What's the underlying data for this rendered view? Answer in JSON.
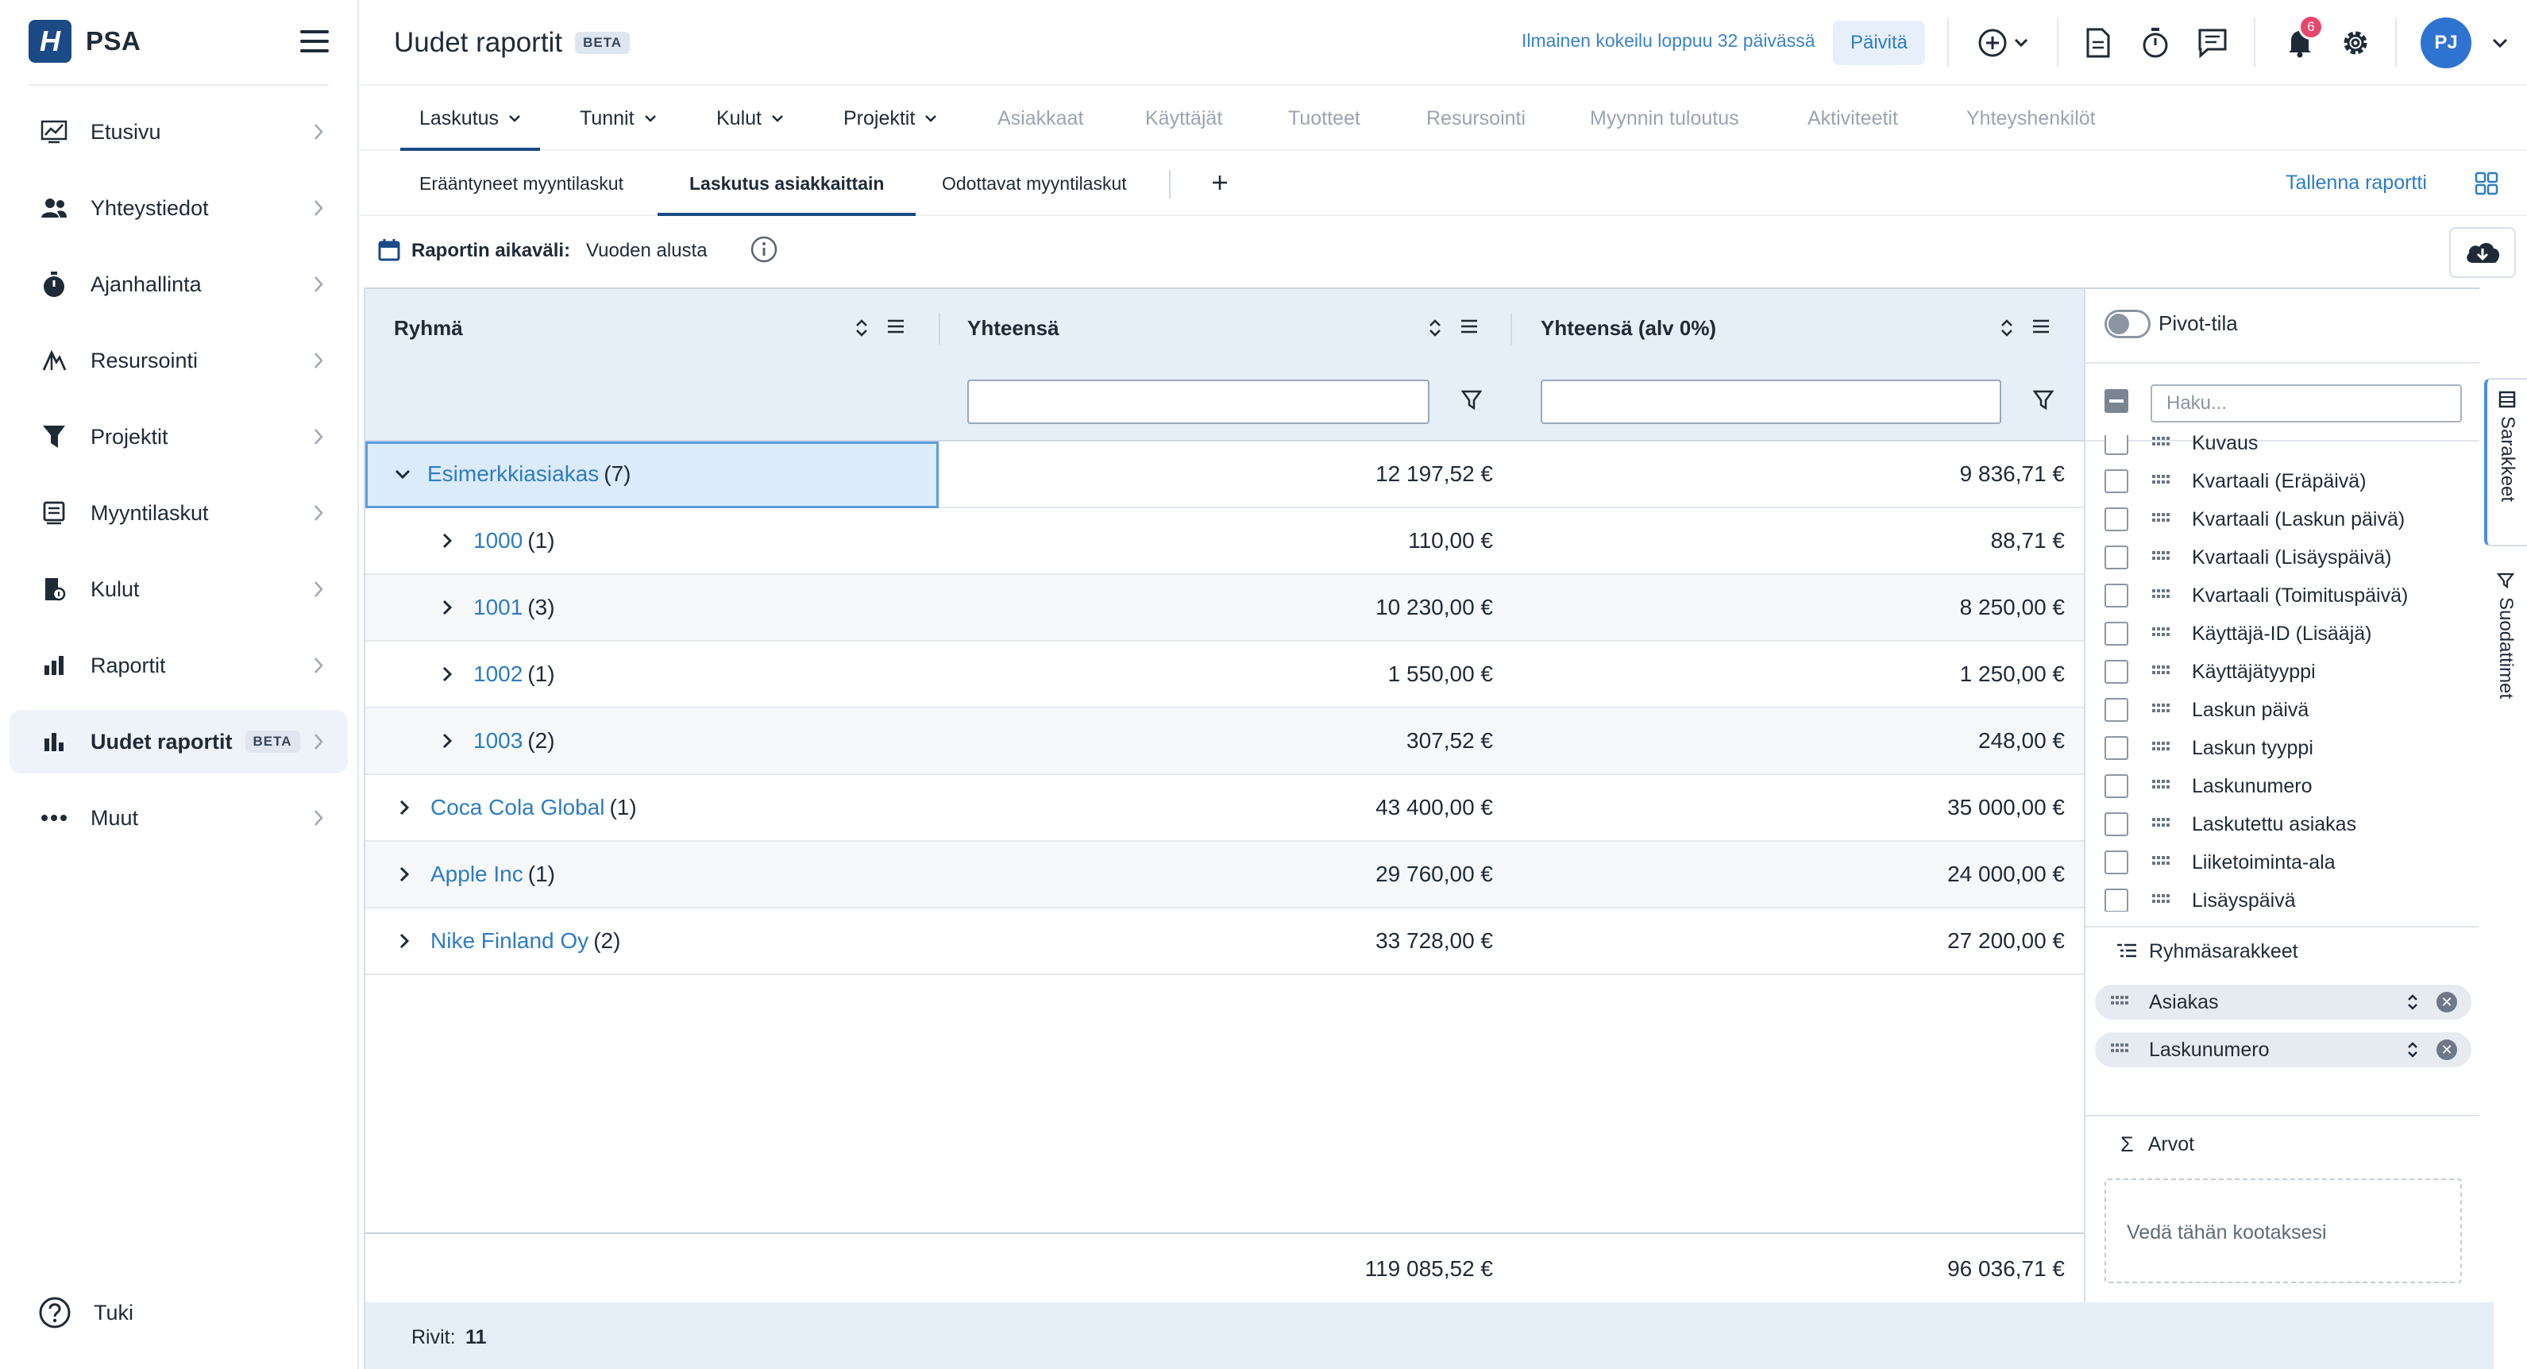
{
  "brand": {
    "logo_letter": "H",
    "name": "PSA"
  },
  "sidebar": {
    "items": [
      {
        "label": "Etusivu",
        "icon": "chart-line-icon"
      },
      {
        "label": "Yhteystiedot",
        "icon": "people-icon"
      },
      {
        "label": "Ajanhallinta",
        "icon": "stopwatch-icon"
      },
      {
        "label": "Resursointi",
        "icon": "resource-icon"
      },
      {
        "label": "Projektit",
        "icon": "funnel-icon"
      },
      {
        "label": "Myyntilaskut",
        "icon": "invoice-icon"
      },
      {
        "label": "Kulut",
        "icon": "receipt-icon"
      },
      {
        "label": "Raportit",
        "icon": "bar-chart-icon"
      },
      {
        "label": "Uudet raportit",
        "icon": "bar-chart-icon",
        "badge": "BETA",
        "active": true
      },
      {
        "label": "Muut",
        "icon": "more-icon"
      }
    ],
    "help_label": "Tuki"
  },
  "header": {
    "title": "Uudet raportit",
    "title_badge": "BETA",
    "trial_text": "Ilmainen kokeilu loppuu 32 päivässä",
    "update_button": "Päivitä",
    "notification_count": "6",
    "avatar_initials": "PJ"
  },
  "main_tabs": [
    {
      "label": "Laskutus",
      "dropdown": true,
      "active": true
    },
    {
      "label": "Tunnit",
      "dropdown": true
    },
    {
      "label": "Kulut",
      "dropdown": true
    },
    {
      "label": "Projektit",
      "dropdown": true
    },
    {
      "label": "Asiakkaat",
      "disabled": true
    },
    {
      "label": "Käyttäjät",
      "disabled": true
    },
    {
      "label": "Tuotteet",
      "disabled": true
    },
    {
      "label": "Resursointi",
      "disabled": true
    },
    {
      "label": "Myynnin tuloutus",
      "disabled": true
    },
    {
      "label": "Aktiviteetit",
      "disabled": true
    },
    {
      "label": "Yhteyshenkilöt",
      "disabled": true
    }
  ],
  "sub_tabs": [
    {
      "label": "Erääntyneet myyntilaskut"
    },
    {
      "label": "Laskutus asiakkaittain",
      "active": true
    },
    {
      "label": "Odottavat myyntilaskut"
    }
  ],
  "save_report": "Tallenna raportti",
  "range": {
    "label": "Raportin aikaväli:",
    "value": "Vuoden alusta"
  },
  "grid": {
    "columns": [
      "Ryhmä",
      "Yhteensä",
      "Yhteensä (alv 0%)"
    ],
    "rows": [
      {
        "level": 0,
        "expanded": true,
        "name": "Esimerkkiasiakas",
        "count": "(7)",
        "total": "12 197,52 €",
        "net": "9 836,71 €"
      },
      {
        "level": 1,
        "name": "1000",
        "count": "(1)",
        "total": "110,00 €",
        "net": "88,71 €"
      },
      {
        "level": 1,
        "name": "1001",
        "count": "(3)",
        "total": "10 230,00 €",
        "net": "8 250,00 €"
      },
      {
        "level": 1,
        "name": "1002",
        "count": "(1)",
        "total": "1 550,00 €",
        "net": "1 250,00 €"
      },
      {
        "level": 1,
        "name": "1003",
        "count": "(2)",
        "total": "307,52 €",
        "net": "248,00 €"
      },
      {
        "level": 0,
        "name": "Coca Cola Global",
        "count": "(1)",
        "total": "43 400,00 €",
        "net": "35 000,00 €"
      },
      {
        "level": 0,
        "name": "Apple Inc",
        "count": "(1)",
        "total": "29 760,00 €",
        "net": "24 000,00 €"
      },
      {
        "level": 0,
        "name": "Nike Finland Oy",
        "count": "(2)",
        "total": "33 728,00 €",
        "net": "27 200,00 €"
      }
    ],
    "totals": {
      "total": "119 085,52 €",
      "net": "96 036,71 €"
    },
    "rows_label": "Rivit:",
    "rows_count": "11"
  },
  "panel": {
    "pivot_label": "Pivot-tila",
    "search_placeholder": "Haku...",
    "columns_list": [
      "Kuvaus",
      "Kvartaali (Eräpäivä)",
      "Kvartaali (Laskun päivä)",
      "Kvartaali (Lisäyspäivä)",
      "Kvartaali (Toimituspäivä)",
      "Käyttäjä-ID (Lisääjä)",
      "Käyttäjätyyppi",
      "Laskun päivä",
      "Laskun tyyppi",
      "Laskunumero",
      "Laskutettu asiakas",
      "Liiketoiminta-ala",
      "Lisäyspäivä"
    ],
    "group_title": "Ryhmäsarakkeet",
    "group_chips": [
      "Asiakas",
      "Laskunumero"
    ],
    "values_title": "Arvot",
    "dropzone_text": "Vedä tähän kootaksesi",
    "side_tabs": [
      "Sarakkeet",
      "Suodattimet"
    ]
  },
  "colors": {
    "accent": "#1b4a85",
    "link": "#2d7cc4",
    "header_bg": "#e6eef7",
    "badge": "#e8476c"
  }
}
